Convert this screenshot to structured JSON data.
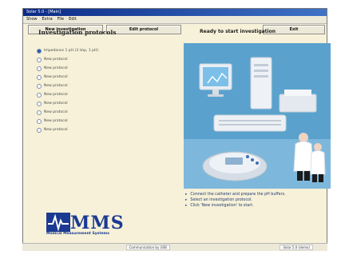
{
  "window": {
    "title": "Solar 5.0 - [Main]"
  },
  "menu": {
    "items": [
      "Show",
      "Extra",
      "File",
      "Edit"
    ]
  },
  "toolbar": {
    "new_investigation": "New investigation",
    "edit_protocol": "Edit protocol",
    "exit": "Exit"
  },
  "left": {
    "section_title": "Investigation protocols",
    "protocols": [
      {
        "label": "Impedance 1 pH (3 imp, 1 pH)",
        "selected": true
      },
      {
        "label": "New protocol",
        "selected": false
      },
      {
        "label": "New protocol",
        "selected": false
      },
      {
        "label": "New protocol",
        "selected": false
      },
      {
        "label": "New protocol",
        "selected": false
      },
      {
        "label": "New protocol",
        "selected": false
      },
      {
        "label": "New protocol",
        "selected": false
      },
      {
        "label": "New protocol",
        "selected": false
      },
      {
        "label": "New protocol",
        "selected": false
      },
      {
        "label": "New protocol",
        "selected": false
      }
    ]
  },
  "right": {
    "status_title": "Ready to start investigation",
    "instructions": [
      "Connect the catheter and prepare the pH buffers.",
      "Select an investigation protocol.",
      "Click 'New investigation' to start."
    ]
  },
  "logo": {
    "name": "MMS",
    "subtitle": "Medical Measurement Systems"
  },
  "status": {
    "left": "Communication by USB",
    "right": "Solar 5.0 (demo)"
  },
  "colors": {
    "background": "#f6f1d8",
    "accent": "#1b3a91",
    "scene": "#5aa2cd"
  }
}
